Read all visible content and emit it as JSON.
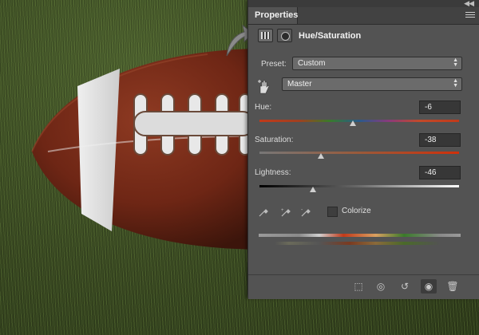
{
  "panel": {
    "tab_label": "Properties",
    "adjustment_title": "Hue/Saturation",
    "preset_label": "Preset:",
    "preset_value": "Custom",
    "channel_value": "Master",
    "hue_label": "Hue:",
    "hue_value": "-6",
    "saturation_label": "Saturation:",
    "saturation_value": "-38",
    "lightness_label": "Lightness:",
    "lightness_value": "-46",
    "colorize_label": "Colorize",
    "colors": {
      "panel_bg": "#535353",
      "field_bg": "#373737",
      "dropdown_bg": "#6b6b6b"
    },
    "icons": [
      "collapse-icon",
      "panel-menu-icon",
      "hue-sat-adjustment-icon",
      "mask-icon",
      "on-image-adjust-hand-icon",
      "eyedropper-icon",
      "eyedropper-plus-icon",
      "eyedropper-minus-icon",
      "clip-to-layer-icon",
      "view-previous-state-icon",
      "reset-icon",
      "visibility-eye-icon",
      "trash-icon"
    ]
  }
}
